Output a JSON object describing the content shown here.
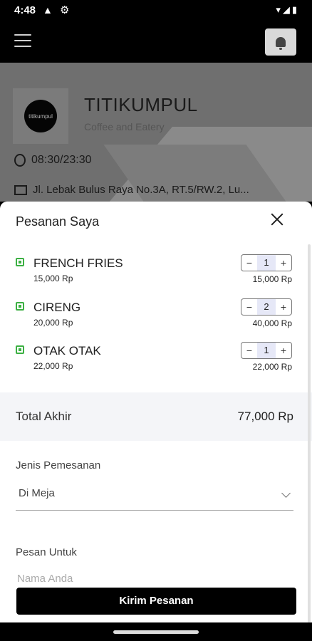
{
  "status_bar": {
    "time": "4:48"
  },
  "store": {
    "logo_text": "titikumpul",
    "name": "TITIKUMPUL",
    "subtitle": "Coffee and Eatery",
    "hours": "08:30/23:30",
    "address": "Jl. Lebak Bulus Raya No.3A, RT.5/RW.2, Lu..."
  },
  "sheet": {
    "title": "Pesanan Saya",
    "items": [
      {
        "name": "FRENCH FRIES",
        "price": "15,000 Rp",
        "qty": "1",
        "total": "15,000 Rp"
      },
      {
        "name": "CIRENG",
        "price": "20,000 Rp",
        "qty": "2",
        "total": "40,000 Rp"
      },
      {
        "name": "OTAK OTAK",
        "price": "22,000 Rp",
        "qty": "1",
        "total": "22,000 Rp"
      }
    ],
    "stepper": {
      "minus": "−",
      "plus": "+"
    },
    "total_label": "Total Akhir",
    "total_value": "77,000 Rp",
    "order_type_label": "Jenis Pemesanan",
    "order_type_value": "Di Meja",
    "order_for_label": "Pesan Untuk",
    "name_placeholder": "Nama Anda",
    "submit_label": "Kirim Pesanan"
  },
  "colors": {
    "veg": "#3cb043",
    "stepper_qty_bg": "#e6e8f7",
    "total_row_bg": "#f4f5f8"
  }
}
